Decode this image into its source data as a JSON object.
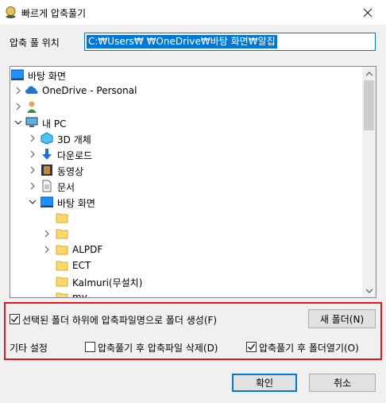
{
  "window": {
    "title": "빠르게 압축풀기",
    "close_label": "✕"
  },
  "path": {
    "label": "압축 풀 위치",
    "value": "C:₩Users₩      ₩OneDrive₩바탕 화면₩알집"
  },
  "tree": {
    "items": [
      {
        "label": "바탕 화면",
        "icon": "desktop-icon"
      },
      {
        "label": "OneDrive - Personal",
        "icon": "cloud-icon"
      },
      {
        "label": "",
        "icon": "user-icon"
      },
      {
        "label": "내 PC",
        "icon": "computer-icon"
      },
      {
        "label": "3D 개체",
        "icon": "3d-objects-icon"
      },
      {
        "label": "다운로드",
        "icon": "download-icon"
      },
      {
        "label": "동영상",
        "icon": "video-icon"
      },
      {
        "label": "문서",
        "icon": "document-icon"
      },
      {
        "label": "바탕 화면",
        "icon": "desktop-icon"
      },
      {
        "label": "",
        "icon": "folder-icon"
      },
      {
        "label": "",
        "icon": "folder-icon"
      },
      {
        "label": "ALPDF",
        "icon": "folder-icon"
      },
      {
        "label": "ECT",
        "icon": "folder-icon"
      },
      {
        "label": "Kalmuri(무설치)",
        "icon": "folder-icon"
      },
      {
        "label": "my",
        "icon": "folder-icon"
      }
    ]
  },
  "options": {
    "create_folder": {
      "label": "선택된 폴더 하위에 압축파일명으로 폴더 생성(F)",
      "checked": true
    },
    "new_folder_button": "새 폴더(N)",
    "other_settings_label": "기타 설정",
    "delete_after": {
      "label": "압축풀기 후 압축파일 삭제(D)",
      "checked": false
    },
    "open_folder_after": {
      "label": "압축풀기 후 폴더열기(O)",
      "checked": true
    }
  },
  "buttons": {
    "ok": "확인",
    "cancel": "취소"
  },
  "colors": {
    "accent": "#0078d7",
    "highlight_border": "#e0161b"
  }
}
